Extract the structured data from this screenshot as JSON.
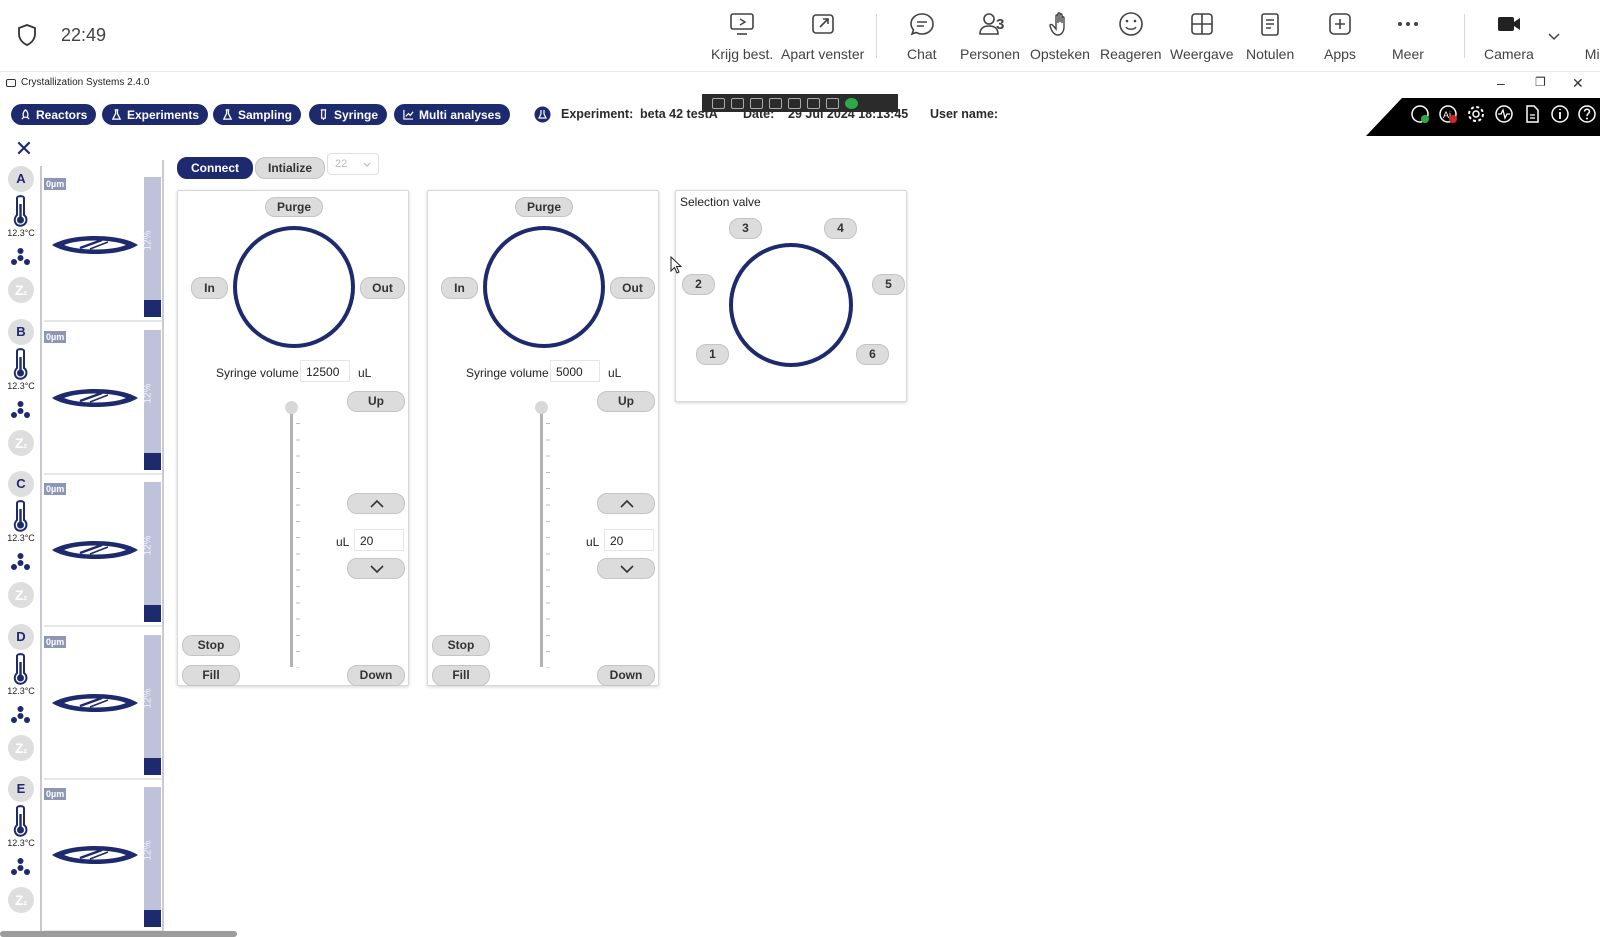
{
  "teams": {
    "clock": "22:49",
    "buttons": [
      {
        "label": "Krijg best.",
        "icon": "share-screen-icon"
      },
      {
        "label": "Apart venster",
        "icon": "pop-out-icon"
      },
      {
        "label": "Chat",
        "icon": "chat-icon"
      },
      {
        "label": "Personen",
        "icon": "people-icon",
        "count": "3"
      },
      {
        "label": "Opsteken",
        "icon": "raise-hand-icon"
      },
      {
        "label": "Reageren",
        "icon": "react-icon"
      },
      {
        "label": "Weergave",
        "icon": "view-icon"
      },
      {
        "label": "Notulen",
        "icon": "notes-icon"
      },
      {
        "label": "Apps",
        "icon": "apps-icon"
      },
      {
        "label": "Meer",
        "icon": "more-icon"
      },
      {
        "label": "Camera",
        "icon": "camera-icon"
      },
      {
        "label": "Micr",
        "icon": "mic-icon"
      }
    ]
  },
  "app": {
    "title": "Crystallization Systems 2.4.0",
    "window_controls": {
      "minimize": "–",
      "restore": "❐",
      "close": "✕"
    }
  },
  "nav": {
    "buttons": [
      "Reactors",
      "Experiments",
      "Sampling",
      "Syringe",
      "Multi analyses"
    ],
    "experiment_label": "Experiment:",
    "experiment_value": "beta 42 testA",
    "date_label": "Date:",
    "date_value": "29 Jul 2024 18:13:45",
    "user_label": "User name:"
  },
  "colors": {
    "accent": "#1e2a6e",
    "pill": "#dcdcdc",
    "bar_bg": "#bfc3d9"
  },
  "reactors": [
    {
      "letter": "A",
      "temp": "12.3°C",
      "size": "0µm",
      "level": "12%",
      "level_fraction": 0.12
    },
    {
      "letter": "B",
      "temp": "12.3°C",
      "size": "0µm",
      "level": "12%",
      "level_fraction": 0.12
    },
    {
      "letter": "C",
      "temp": "12.3°C",
      "size": "0µm",
      "level": "12%",
      "level_fraction": 0.12
    },
    {
      "letter": "D",
      "temp": "12.3°C",
      "size": "0µm",
      "level": "12%",
      "level_fraction": 0.12
    },
    {
      "letter": "E",
      "temp": "12.3°C",
      "size": "0µm",
      "level": "12%",
      "level_fraction": 0.12
    }
  ],
  "controls": {
    "connect": "Connect",
    "initialize": "Intialize",
    "port_select": "22"
  },
  "syringes": [
    {
      "purge": "Purge",
      "in": "In",
      "out": "Out",
      "volume_label": "Syringe volume",
      "volume": "12500",
      "unit": "uL",
      "up": "Up",
      "step_unit": "uL",
      "step": "20",
      "stop": "Stop",
      "fill": "Fill",
      "down": "Down"
    },
    {
      "purge": "Purge",
      "in": "In",
      "out": "Out",
      "volume_label": "Syringe volume",
      "volume": "5000",
      "unit": "uL",
      "up": "Up",
      "step_unit": "uL",
      "step": "20",
      "stop": "Stop",
      "fill": "Fill",
      "down": "Down"
    }
  ],
  "valve": {
    "title": "Selection valve",
    "ports": [
      "1",
      "2",
      "3",
      "4",
      "5",
      "6"
    ]
  }
}
